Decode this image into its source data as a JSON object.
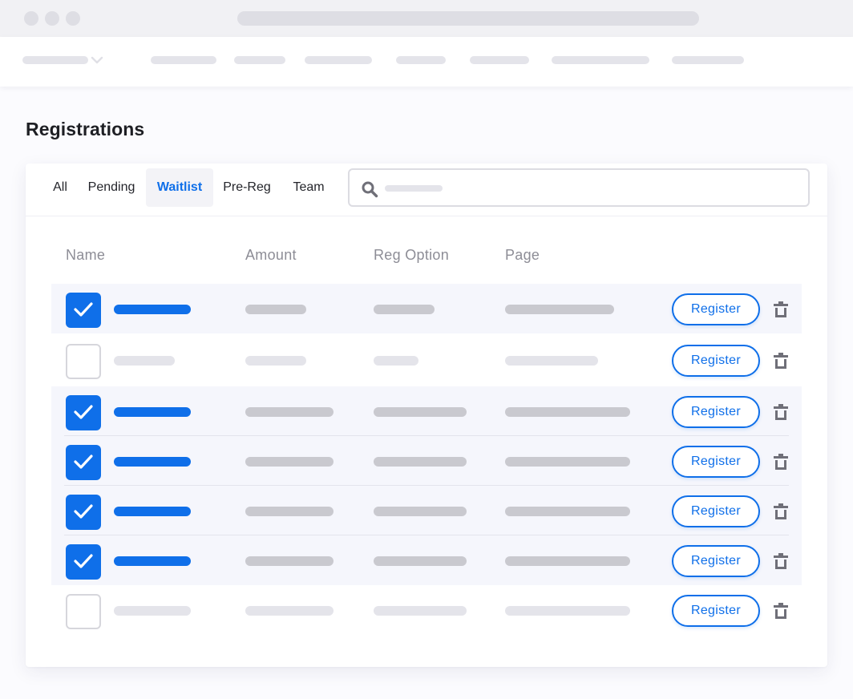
{
  "page": {
    "title": "Registrations"
  },
  "tabs": [
    {
      "label": "All",
      "active": false
    },
    {
      "label": "Pending",
      "active": false
    },
    {
      "label": "Waitlist",
      "active": true
    },
    {
      "label": "Pre-Reg",
      "active": false
    },
    {
      "label": "Team",
      "active": false
    }
  ],
  "table": {
    "columns": [
      "Name",
      "Amount",
      "Reg Option",
      "Page"
    ],
    "action_label": "Register",
    "rows": [
      {
        "checked": true
      },
      {
        "checked": false
      },
      {
        "checked": true
      },
      {
        "checked": true
      },
      {
        "checked": true
      },
      {
        "checked": true
      },
      {
        "checked": false
      }
    ]
  },
  "icons": {
    "search": "search-icon",
    "trash": "trash-icon",
    "check": "checkmark-icon",
    "dropdown": "chevron-down-icon"
  },
  "colors": {
    "accent": "#0f6fe9",
    "text": "#1e1f24",
    "muted": "#8d8d96",
    "placeholder_dark": "#c9c9cf",
    "placeholder_light": "#e4e4ea"
  }
}
